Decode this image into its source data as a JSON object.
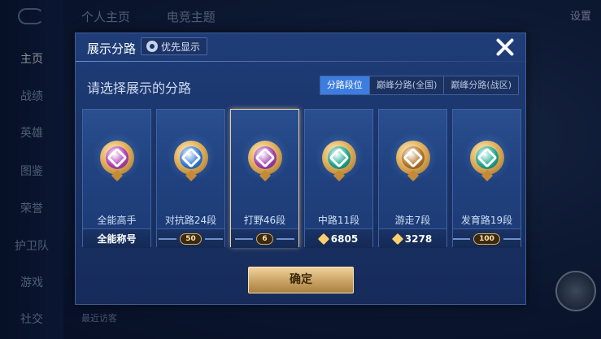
{
  "background": {
    "top_tabs": [
      "个人主页",
      "电竞主题"
    ],
    "settings_label": "设置",
    "nav_items": [
      "主页",
      "战绩",
      "英雄",
      "图鉴",
      "荣誉",
      "护卫队",
      "游戏",
      "社交"
    ],
    "visitor_label": "最近访客"
  },
  "dialog": {
    "title": "展示分路",
    "priority_button": "优先显示",
    "subtitle": "请选择展示的分路",
    "tabs": [
      {
        "label": "分路段位",
        "active": true
      },
      {
        "label": "巅峰分路(全国)",
        "active": false
      },
      {
        "label": "巅峰分路(战区)",
        "active": false
      }
    ],
    "cards": [
      {
        "name": "全能高手",
        "foot_text": "全能称号",
        "core_color": "#b23fb5",
        "selected": false
      },
      {
        "name": "对抗路24段",
        "badge": "50",
        "core_color": "#2f79d8",
        "selected": false
      },
      {
        "name": "打野46段",
        "badge": "6",
        "core_color": "#a13db0",
        "selected": true
      },
      {
        "name": "中路11段",
        "points": "6805",
        "core_color": "#1aa88f",
        "selected": false
      },
      {
        "name": "游走7段",
        "core_color": "#b5752a",
        "points": "3278",
        "selected": false
      },
      {
        "name": "发育路19段",
        "badge": "100",
        "core_color": "#1aa88f",
        "selected": false
      }
    ],
    "confirm_label": "确定"
  }
}
